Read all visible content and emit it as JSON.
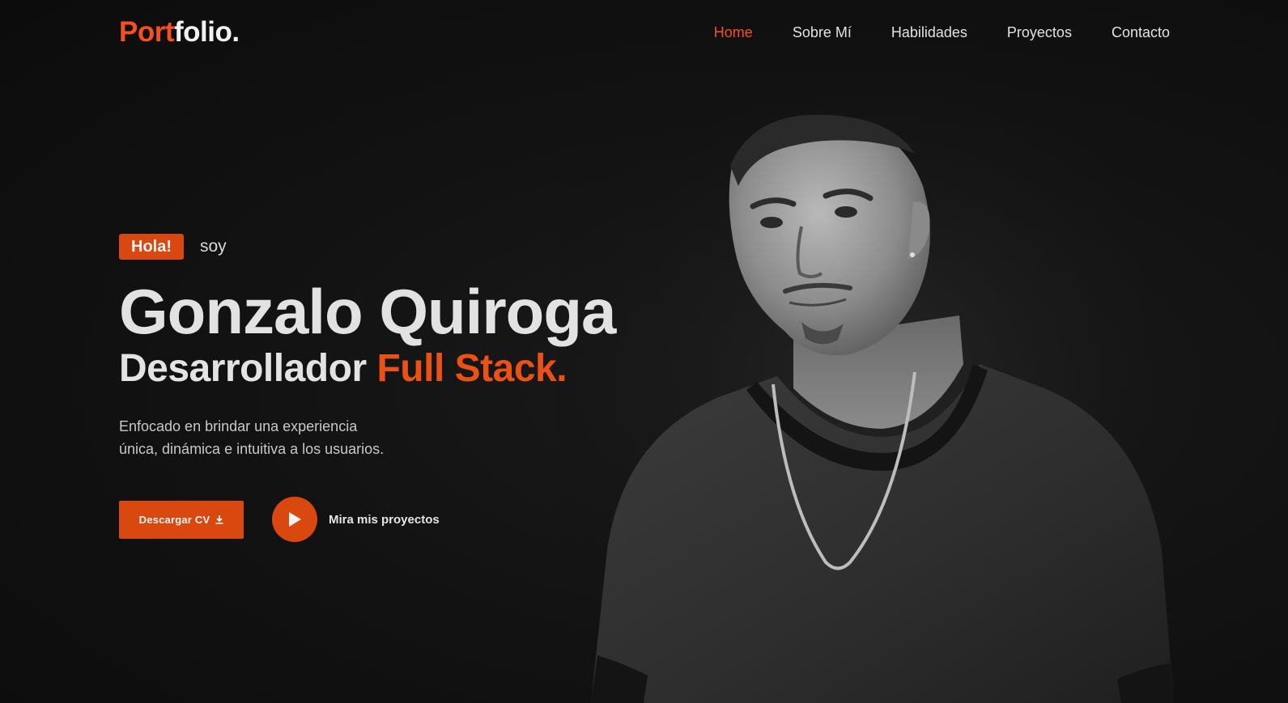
{
  "nav": {
    "logo_accent": "Port",
    "logo_rest": "folio.",
    "links": [
      {
        "label": "Home",
        "active": true
      },
      {
        "label": "Sobre Mí"
      },
      {
        "label": "Habilidades"
      },
      {
        "label": "Proyectos"
      },
      {
        "label": "Contacto"
      }
    ]
  },
  "hero": {
    "badge": "Hola!",
    "greeting": "soy",
    "name": "Gonzalo Quiroga",
    "role_prefix": "Desarrollador",
    "role_highlight": "Full Stack.",
    "description_line1": "Enfocado en brindar una experiencia",
    "description_line2": "única, dinámica e intuitiva a los usuarios.",
    "cv_button": "Descargar CV",
    "cv_icon": "download-icon",
    "play_icon": "play-icon",
    "projects_link": "Mira mis proyectos"
  },
  "theme": {
    "accent": "#d9480f",
    "background": "#0f0f0f",
    "text": "#e2e2e2"
  }
}
